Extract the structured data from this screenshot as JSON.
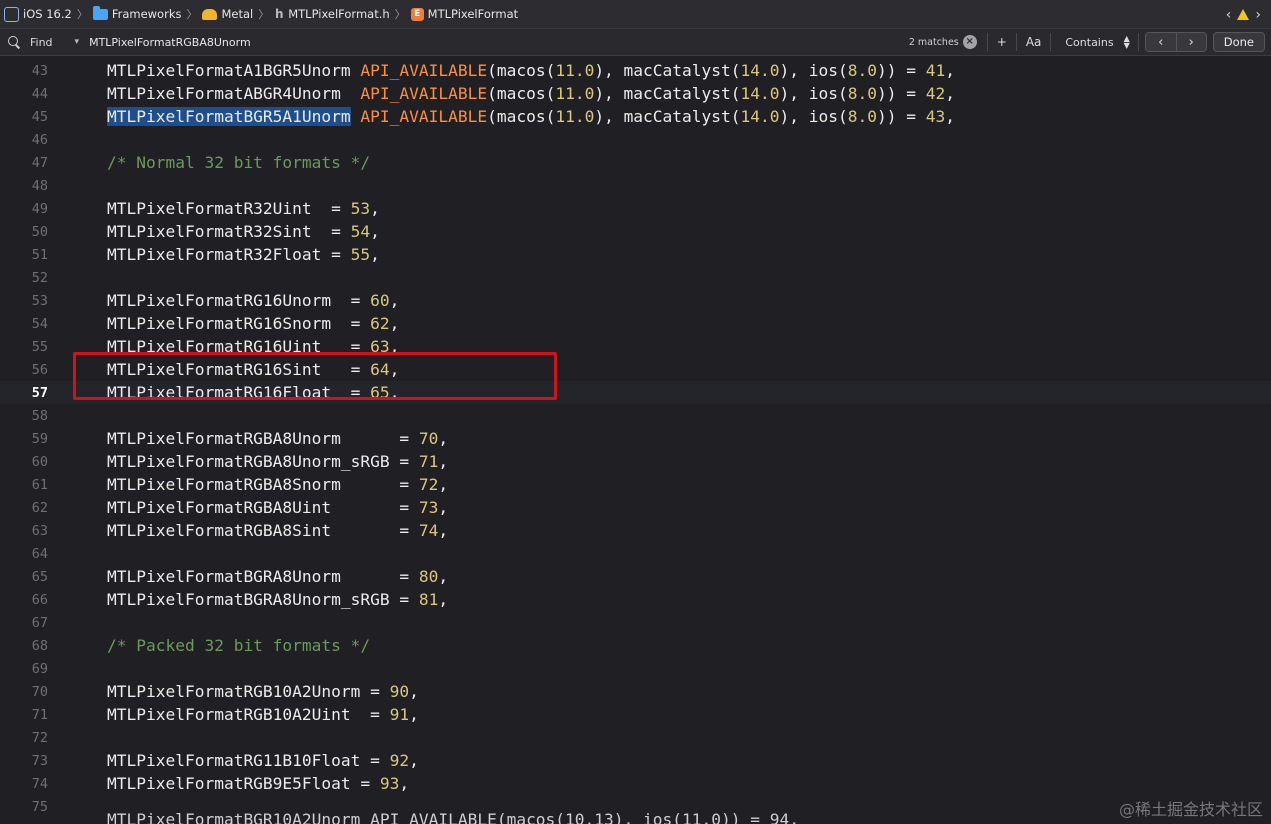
{
  "jumpbar": {
    "crumbs": [
      {
        "icon": "ios-sdk-icon",
        "label": "iOS 16.2"
      },
      {
        "icon": "folder-icon",
        "label": "Frameworks"
      },
      {
        "icon": "metal-framework-icon",
        "label": "Metal"
      },
      {
        "icon": "header-file-icon",
        "label": "MTLPixelFormat.h"
      },
      {
        "icon": "enum-icon",
        "label": "MTLPixelFormat"
      }
    ],
    "right_icons": [
      "chevron-left-icon",
      "warning-icon",
      "chevron-right-icon"
    ]
  },
  "findbar": {
    "mode": "Find",
    "query": "MTLPixelFormatRGBA8Unorm",
    "matches": "2 matches",
    "add_label": "+",
    "case_label": "Aa",
    "match_type": "Contains",
    "prev": "‹",
    "next": "›",
    "done": "Done"
  },
  "editor": {
    "current_line": 57,
    "lines": [
      {
        "n": "43",
        "code": "MTLPixelFormatA1BGR5Unorm API_AVAILABLE(macos(11.0), macCatalyst(14.0), ios(8.0)) = 41,"
      },
      {
        "n": "44",
        "code": "MTLPixelFormatABGR4Unorm  API_AVAILABLE(macos(11.0), macCatalyst(14.0), ios(8.0)) = 42,"
      },
      {
        "n": "45",
        "code": "MTLPixelFormatBGR5A1Unorm API_AVAILABLE(macos(11.0), macCatalyst(14.0), ios(8.0)) = 43,"
      },
      {
        "n": "46",
        "code": ""
      },
      {
        "n": "47",
        "code": "/* Normal 32 bit formats */"
      },
      {
        "n": "48",
        "code": ""
      },
      {
        "n": "49",
        "code": "MTLPixelFormatR32Uint  = 53,"
      },
      {
        "n": "50",
        "code": "MTLPixelFormatR32Sint  = 54,"
      },
      {
        "n": "51",
        "code": "MTLPixelFormatR32Float = 55,"
      },
      {
        "n": "52",
        "code": ""
      },
      {
        "n": "53",
        "code": "MTLPixelFormatRG16Unorm  = 60,"
      },
      {
        "n": "54",
        "code": "MTLPixelFormatRG16Snorm  = 62,"
      },
      {
        "n": "55",
        "code": "MTLPixelFormatRG16Uint   = 63,"
      },
      {
        "n": "56",
        "code": "MTLPixelFormatRG16Sint   = 64,"
      },
      {
        "n": "57",
        "code": "MTLPixelFormatRG16Float  = 65,"
      },
      {
        "n": "58",
        "code": ""
      },
      {
        "n": "59",
        "code": "MTLPixelFormatRGBA8Unorm      = 70,"
      },
      {
        "n": "60",
        "code": "MTLPixelFormatRGBA8Unorm_sRGB = 71,"
      },
      {
        "n": "61",
        "code": "MTLPixelFormatRGBA8Snorm      = 72,"
      },
      {
        "n": "62",
        "code": "MTLPixelFormatRGBA8Uint       = 73,"
      },
      {
        "n": "63",
        "code": "MTLPixelFormatRGBA8Sint       = 74,"
      },
      {
        "n": "64",
        "code": ""
      },
      {
        "n": "65",
        "code": "MTLPixelFormatBGRA8Unorm      = 80,"
      },
      {
        "n": "66",
        "code": "MTLPixelFormatBGRA8Unorm_sRGB = 81,"
      },
      {
        "n": "67",
        "code": ""
      },
      {
        "n": "68",
        "code": "/* Packed 32 bit formats */"
      },
      {
        "n": "69",
        "code": ""
      },
      {
        "n": "70",
        "code": "MTLPixelFormatRGB10A2Unorm = 90,"
      },
      {
        "n": "71",
        "code": "MTLPixelFormatRGB10A2Uint  = 91,"
      },
      {
        "n": "72",
        "code": ""
      },
      {
        "n": "73",
        "code": "MTLPixelFormatRG11B10Float = 92,"
      },
      {
        "n": "74",
        "code": "MTLPixelFormatRGB9E5Float = 93,"
      },
      {
        "n": "75",
        "code": ""
      }
    ],
    "selected_match": "MTLPixelFormatBGR5A1Unorm",
    "annotation": "red-highlight-box",
    "partial_next_line": "MTLPixelFormatBGR10A2Unorm API_AVAILABLE(macos(10.13), ios(11.0)) = 94,"
  },
  "watermark": "@稀土掘金技术社区",
  "colors": {
    "background": "#1f1f24",
    "keyword": "#fd8f3f",
    "number": "#d9c97c",
    "comment": "#6c9a5b",
    "selection": "#1f4e8f",
    "annotation_box": "#d0121b"
  }
}
